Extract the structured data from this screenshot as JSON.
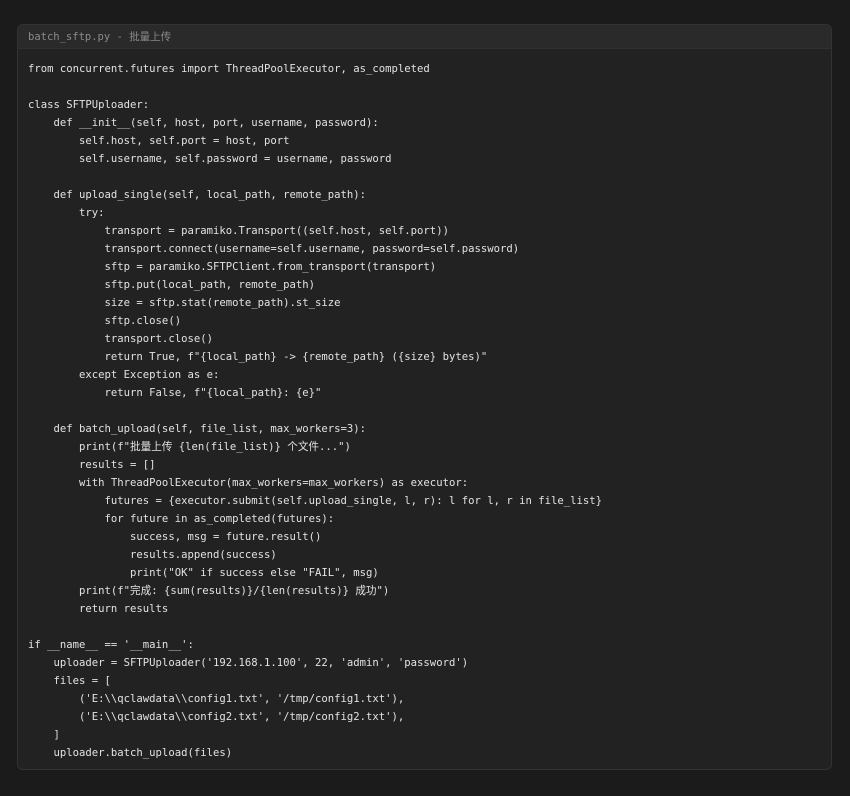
{
  "window": {
    "title": "batch_sftp.py - 批量上传"
  },
  "code_lines": [
    "from concurrent.futures import ThreadPoolExecutor, as_completed",
    "",
    "class SFTPUploader:",
    "    def __init__(self, host, port, username, password):",
    "        self.host, self.port = host, port",
    "        self.username, self.password = username, password",
    "",
    "    def upload_single(self, local_path, remote_path):",
    "        try:",
    "            transport = paramiko.Transport((self.host, self.port))",
    "            transport.connect(username=self.username, password=self.password)",
    "            sftp = paramiko.SFTPClient.from_transport(transport)",
    "            sftp.put(local_path, remote_path)",
    "            size = sftp.stat(remote_path).st_size",
    "            sftp.close()",
    "            transport.close()",
    "            return True, f\"{local_path} -> {remote_path} ({size} bytes)\"",
    "        except Exception as e:",
    "            return False, f\"{local_path}: {e}\"",
    "",
    "    def batch_upload(self, file_list, max_workers=3):",
    "        print(f\"批量上传 {len(file_list)} 个文件...\")",
    "        results = []",
    "        with ThreadPoolExecutor(max_workers=max_workers) as executor:",
    "            futures = {executor.submit(self.upload_single, l, r): l for l, r in file_list}",
    "            for future in as_completed(futures):",
    "                success, msg = future.result()",
    "                results.append(success)",
    "                print(\"OK\" if success else \"FAIL\", msg)",
    "        print(f\"完成: {sum(results)}/{len(results)} 成功\")",
    "        return results",
    "",
    "if __name__ == '__main__':",
    "    uploader = SFTPUploader('192.168.1.100', 22, 'admin', 'password')",
    "    files = [",
    "        ('E:\\\\qclawdata\\\\config1.txt', '/tmp/config1.txt'),",
    "        ('E:\\\\qclawdata\\\\config2.txt', '/tmp/config2.txt'),",
    "    ]",
    "    uploader.batch_upload(files)"
  ],
  "colors": {
    "page_background": "#1b1b1b",
    "panel_background": "#222222",
    "titlebar_background": "#2a2a2a",
    "title_text": "#8a8a8a",
    "code_text": "#e2e2e2"
  }
}
